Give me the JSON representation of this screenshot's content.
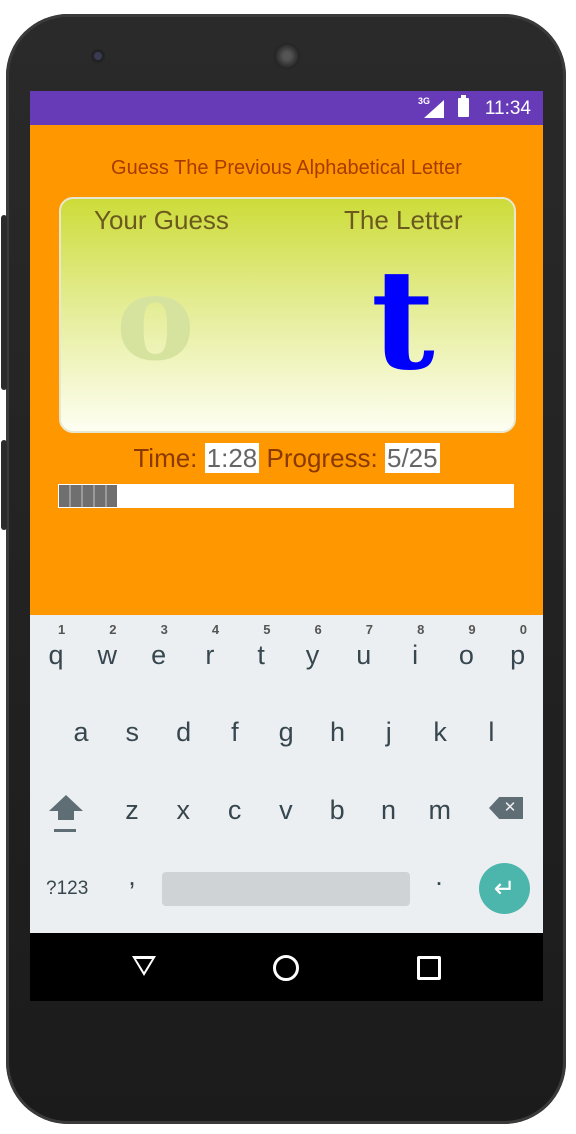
{
  "status_bar": {
    "network": "3G",
    "time": "11:34"
  },
  "app": {
    "heading": "Guess The Previous Alphabetical Letter",
    "card": {
      "guess_label": "Your Guess",
      "letter_label": "The Letter",
      "guess_char": "o",
      "letter_char": "t"
    },
    "time_label": "Time:",
    "time_value": "1:28",
    "progress_label": "Progress:",
    "progress_value": "5/25",
    "progress_fraction": 0.2
  },
  "keyboard": {
    "row1": [
      {
        "k": "q",
        "h": "1"
      },
      {
        "k": "w",
        "h": "2"
      },
      {
        "k": "e",
        "h": "3"
      },
      {
        "k": "r",
        "h": "4"
      },
      {
        "k": "t",
        "h": "5"
      },
      {
        "k": "y",
        "h": "6"
      },
      {
        "k": "u",
        "h": "7"
      },
      {
        "k": "i",
        "h": "8"
      },
      {
        "k": "o",
        "h": "9"
      },
      {
        "k": "p",
        "h": "0"
      }
    ],
    "row2": [
      "a",
      "s",
      "d",
      "f",
      "g",
      "h",
      "j",
      "k",
      "l"
    ],
    "row3": [
      "z",
      "x",
      "c",
      "v",
      "b",
      "n",
      "m"
    ],
    "symbols_label": "?123",
    "comma": ",",
    "period": ".",
    "enter_glyph": "↵",
    "backspace_glyph": "✕"
  },
  "colors": {
    "app_background": "#ff9800",
    "status_bar": "#673ab7",
    "letter_color": "#0000ff",
    "enter_key": "#4db6ac"
  }
}
